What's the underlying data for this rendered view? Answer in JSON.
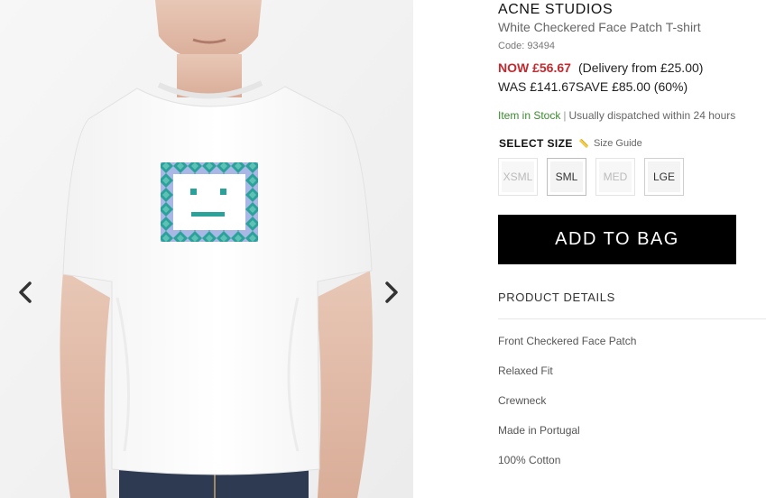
{
  "gallery": {
    "prev_icon": "chevron-left-icon",
    "next_icon": "chevron-right-icon"
  },
  "product": {
    "brand": "ACNE STUDIOS",
    "name": "White Checkered Face Patch T-shirt",
    "code_label": "Code:",
    "code": "93494",
    "price_now": "NOW £56.67",
    "delivery": "(Delivery from £25.00)",
    "price_was": "WAS £141.67",
    "save": "SAVE £85.00 (60%)",
    "stock": "Item in Stock",
    "stock_separator": "|",
    "dispatch": "Usually dispatched within 24 hours"
  },
  "size_selector": {
    "title": "SELECT SIZE",
    "guide_icon": "ruler-icon",
    "guide_label": "Size Guide",
    "options": [
      {
        "label": "XSML",
        "available": false
      },
      {
        "label": "SML",
        "available": true
      },
      {
        "label": "MED",
        "available": false
      },
      {
        "label": "LGE",
        "available": true
      }
    ]
  },
  "cart": {
    "add_label": "ADD TO BAG"
  },
  "details": {
    "heading": "PRODUCT DETAILS",
    "features": [
      "Front Checkered Face Patch",
      "Relaxed Fit",
      "Crewneck",
      "Made in Portugal",
      "100% Cotton"
    ]
  },
  "colors": {
    "sale_price": "#c22a2f",
    "in_stock": "#3c8a30",
    "button_bg": "#000000",
    "patch_teal": "#2aa29a",
    "patch_lilac": "#a9b7e6"
  }
}
